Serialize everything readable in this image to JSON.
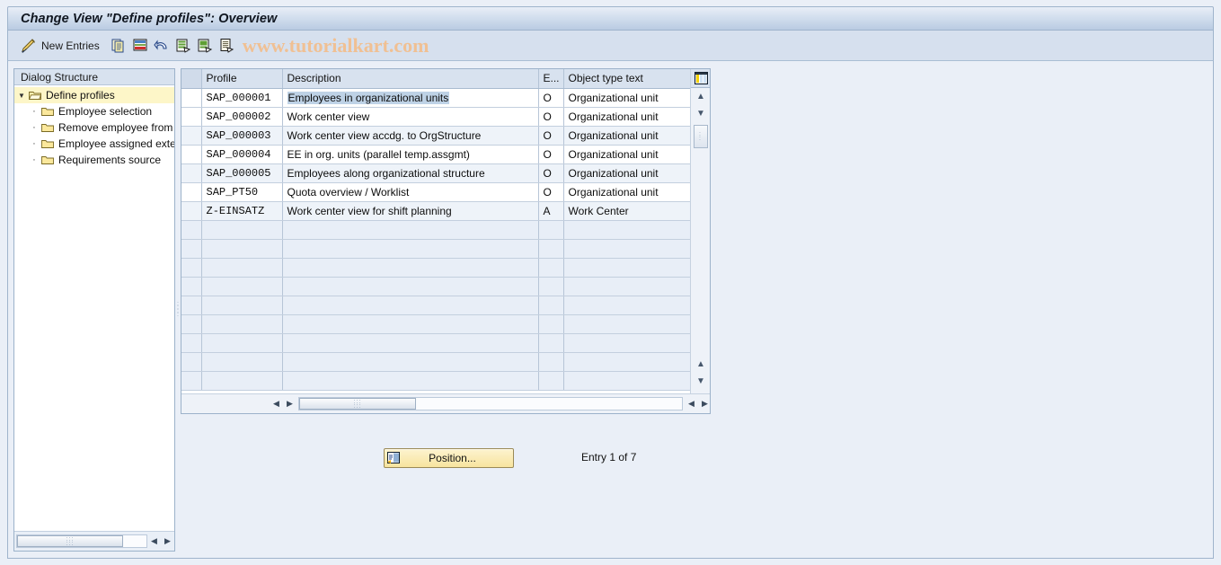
{
  "window": {
    "title": "Change View \"Define profiles\": Overview"
  },
  "toolbar": {
    "new_entries_label": "New Entries",
    "watermark": "www.tutorialkart.com",
    "icons": [
      "pencil-icon",
      "copy-icon",
      "delete-row-icon",
      "undo-icon",
      "select-all-icon",
      "deselect-all-icon",
      "details-icon"
    ]
  },
  "sidebar": {
    "header": "Dialog Structure",
    "items": [
      {
        "label": "Define profiles",
        "icon": "open-folder-icon",
        "level": 0,
        "selected": true
      },
      {
        "label": "Employee selection",
        "icon": "folder-icon",
        "level": 1,
        "selected": false
      },
      {
        "label": "Remove employee from selection",
        "icon": "folder-icon",
        "level": 1,
        "selected": false
      },
      {
        "label": "Employee assigned externally",
        "icon": "folder-icon",
        "level": 1,
        "selected": false
      },
      {
        "label": "Requirements source",
        "icon": "folder-icon",
        "level": 1,
        "selected": false
      }
    ]
  },
  "table": {
    "columns": [
      {
        "key": "profile",
        "label": "Profile"
      },
      {
        "key": "description",
        "label": "Description"
      },
      {
        "key": "e",
        "label": "E..."
      },
      {
        "key": "object_type_text",
        "label": "Object type text"
      }
    ],
    "rows": [
      {
        "profile": "SAP_000001",
        "description": "Employees in organizational units",
        "e": "O",
        "object_type_text": "Organizational unit",
        "highlighted": true
      },
      {
        "profile": "SAP_000002",
        "description": "Work center view",
        "e": "O",
        "object_type_text": "Organizational unit",
        "highlighted": false
      },
      {
        "profile": "SAP_000003",
        "description": "Work center view accdg. to OrgStructure",
        "e": "O",
        "object_type_text": "Organizational unit",
        "highlighted": false
      },
      {
        "profile": "SAP_000004",
        "description": "EE in org. units (parallel temp.assgmt)",
        "e": "O",
        "object_type_text": "Organizational unit",
        "highlighted": false
      },
      {
        "profile": "SAP_000005",
        "description": "Employees along organizational structure",
        "e": "O",
        "object_type_text": "Organizational unit",
        "highlighted": false
      },
      {
        "profile": "SAP_PT50",
        "description": "Quota overview / Worklist",
        "e": "O",
        "object_type_text": "Organizational unit",
        "highlighted": false
      },
      {
        "profile": "Z-EINSATZ",
        "description": "Work center view for shift planning",
        "e": "A",
        "object_type_text": "Work Center",
        "highlighted": false
      }
    ],
    "empty_row_count": 9,
    "config_icon": "table-settings-icon"
  },
  "footer": {
    "position_button": "Position...",
    "position_button_icon": "position-icon",
    "entry_status": "Entry 1 of 7"
  },
  "colors": {
    "title_bar": "#b9cbe2",
    "toolbar_bg": "#d6e0ee",
    "accent_yellow": "#f7e49e",
    "selection_blue": "#bed2e6",
    "watermark": "#f0c093",
    "tree_selected": "#fdf6c8"
  }
}
